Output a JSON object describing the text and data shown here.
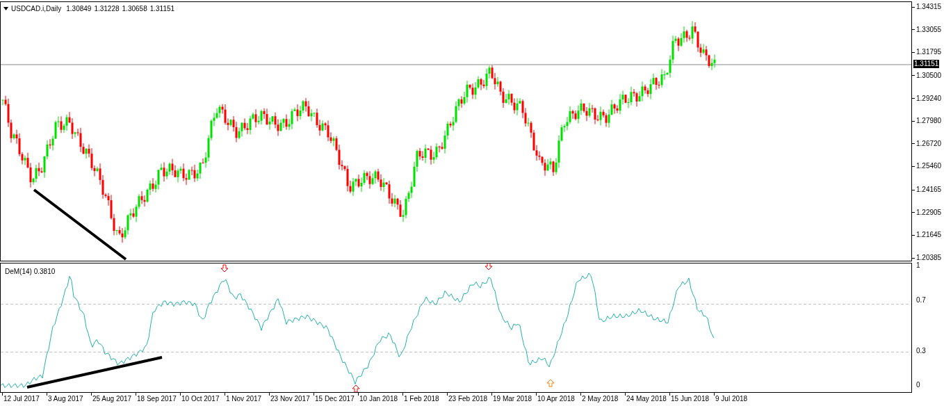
{
  "chart_header": {
    "symbol": "USDCAD.i,Daily",
    "ohlc": [
      "1.30849",
      "1.31228",
      "1.30658",
      "1.31151"
    ]
  },
  "price_axis": {
    "labels": [
      "1.34315",
      "1.33055",
      "1.31795",
      "1.30500",
      "1.29240",
      "1.27980",
      "1.26720",
      "1.25460",
      "1.24165",
      "1.22905",
      "1.21645",
      "1.20385"
    ],
    "current_price": "1.31151"
  },
  "indicator": {
    "title": "DeM(14) 0.3810",
    "axis_labels": [
      "1",
      "0.7",
      "0.3",
      "0"
    ]
  },
  "time_axis": {
    "labels": [
      "12 Jul 2017",
      "3 Aug 2017",
      "25 Aug 2017",
      "18 Sep 2017",
      "10 Oct 2017",
      "1 Nov 2017",
      "23 Nov 2017",
      "15 Dec 2017",
      "10 Jan 2018",
      "1 Feb 2018",
      "23 Feb 2018",
      "19 Mar 2018",
      "10 Apr 2018",
      "2 May 2018",
      "24 May 2018",
      "15 Jun 2018",
      "9 Jul 2018"
    ]
  }
}
